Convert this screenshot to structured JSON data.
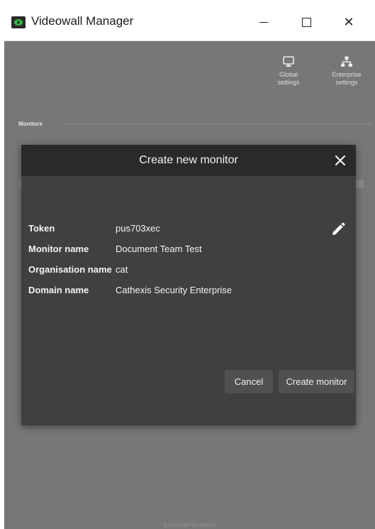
{
  "window": {
    "title": "Videowall Manager",
    "minimize_label": "",
    "maximize_label": "",
    "close_label": "✕"
  },
  "toolbar": {
    "global_settings": "Global\nsettings",
    "global_settings_line1": "Global",
    "global_settings_line2": "settings",
    "enterprise_settings_line1": "Enterprise",
    "enterprise_settings_line2": "settings"
  },
  "monitors": {
    "section_label": "Monitors"
  },
  "dialog": {
    "title": "Create new monitor",
    "fields": [
      {
        "label": "Token",
        "value": "pus703xec"
      },
      {
        "label": "Monitor name",
        "value": "Document Team Test"
      },
      {
        "label": "Organisation name",
        "value": "cat"
      },
      {
        "label": "Domain name",
        "value": "Cathexis Security Enterprise"
      }
    ],
    "cancel_label": "Cancel",
    "create_label": "Create monitor"
  },
  "footer": {
    "version": "5.1.rc9.230715.120613"
  },
  "colors": {
    "accent_green": "#3fb54a",
    "background": "#777777",
    "dialog": "#404040"
  }
}
